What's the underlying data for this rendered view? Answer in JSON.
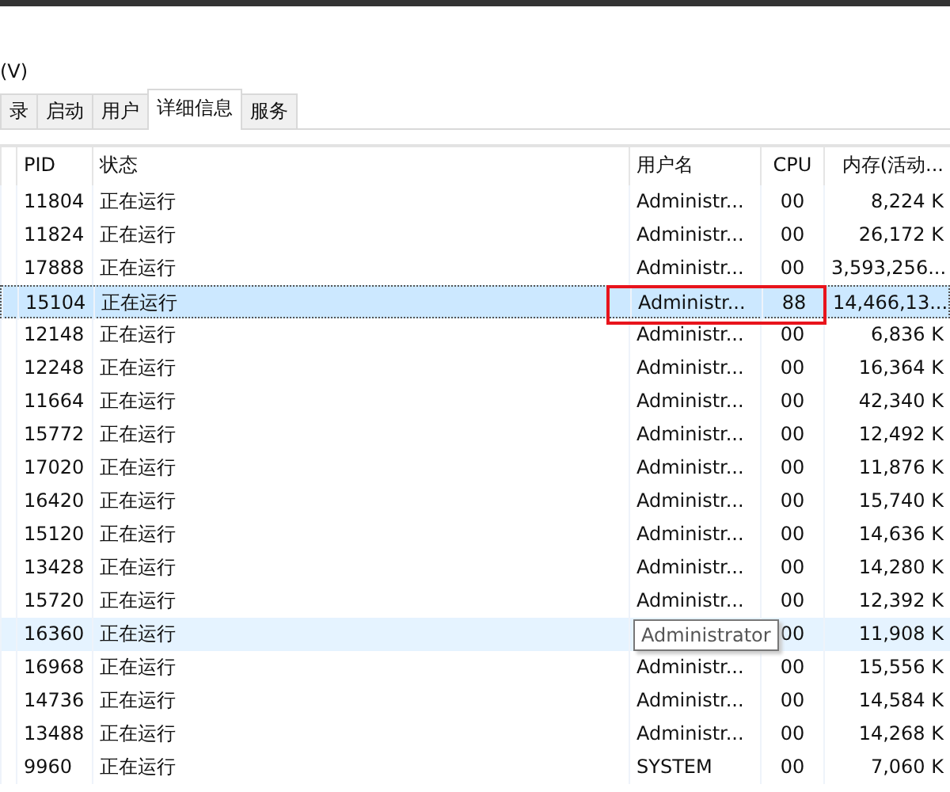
{
  "menu": {
    "label": "(V)"
  },
  "tabs": [
    {
      "label": "录",
      "selected": false
    },
    {
      "label": "启动",
      "selected": false
    },
    {
      "label": "用户",
      "selected": false
    },
    {
      "label": "详细信息",
      "selected": true
    },
    {
      "label": "服务",
      "selected": false
    }
  ],
  "table": {
    "columns": [
      "PID",
      "状态",
      "用户名",
      "CPU",
      "内存(活动..."
    ],
    "rows": [
      {
        "pid": "11804",
        "status": "正在运行",
        "user": "Administr...",
        "cpu": "00",
        "memory": "8,224 K",
        "selected": false,
        "hovered": false,
        "boxed": false
      },
      {
        "pid": "11824",
        "status": "正在运行",
        "user": "Administr...",
        "cpu": "00",
        "memory": "26,172 K",
        "selected": false,
        "hovered": false,
        "boxed": false
      },
      {
        "pid": "17888",
        "status": "正在运行",
        "user": "Administr...",
        "cpu": "00",
        "memory": "3,593,256...",
        "selected": false,
        "hovered": false,
        "boxed": false
      },
      {
        "pid": "15104",
        "status": "正在运行",
        "user": "Administr...",
        "cpu": "88",
        "memory": "14,466,13...",
        "selected": true,
        "hovered": false,
        "boxed": true
      },
      {
        "pid": "12148",
        "status": "正在运行",
        "user": "Administr...",
        "cpu": "00",
        "memory": "6,836 K",
        "selected": false,
        "hovered": false,
        "boxed": false
      },
      {
        "pid": "12248",
        "status": "正在运行",
        "user": "Administr...",
        "cpu": "00",
        "memory": "16,364 K",
        "selected": false,
        "hovered": false,
        "boxed": false
      },
      {
        "pid": "11664",
        "status": "正在运行",
        "user": "Administr...",
        "cpu": "00",
        "memory": "42,340 K",
        "selected": false,
        "hovered": false,
        "boxed": false
      },
      {
        "pid": "15772",
        "status": "正在运行",
        "user": "Administr...",
        "cpu": "00",
        "memory": "12,492 K",
        "selected": false,
        "hovered": false,
        "boxed": false
      },
      {
        "pid": "17020",
        "status": "正在运行",
        "user": "Administr...",
        "cpu": "00",
        "memory": "11,876 K",
        "selected": false,
        "hovered": false,
        "boxed": false
      },
      {
        "pid": "16420",
        "status": "正在运行",
        "user": "Administr...",
        "cpu": "00",
        "memory": "15,740 K",
        "selected": false,
        "hovered": false,
        "boxed": false
      },
      {
        "pid": "15120",
        "status": "正在运行",
        "user": "Administr...",
        "cpu": "00",
        "memory": "14,636 K",
        "selected": false,
        "hovered": false,
        "boxed": false
      },
      {
        "pid": "13428",
        "status": "正在运行",
        "user": "Administr...",
        "cpu": "00",
        "memory": "14,280 K",
        "selected": false,
        "hovered": false,
        "boxed": false
      },
      {
        "pid": "15720",
        "status": "正在运行",
        "user": "Administr...",
        "cpu": "00",
        "memory": "12,392 K",
        "selected": false,
        "hovered": false,
        "boxed": false
      },
      {
        "pid": "16360",
        "status": "正在运行",
        "tooltip": "Administrator",
        "cpu": "00",
        "memory": "11,908 K",
        "selected": false,
        "hovered": true,
        "boxed": false
      },
      {
        "pid": "16968",
        "status": "正在运行",
        "user": "Administr...",
        "cpu": "00",
        "memory": "15,556 K",
        "selected": false,
        "hovered": false,
        "boxed": false
      },
      {
        "pid": "14736",
        "status": "正在运行",
        "user": "Administr...",
        "cpu": "00",
        "memory": "14,584 K",
        "selected": false,
        "hovered": false,
        "boxed": false
      },
      {
        "pid": "13488",
        "status": "正在运行",
        "user": "Administr...",
        "cpu": "00",
        "memory": "14,268 K",
        "selected": false,
        "hovered": false,
        "boxed": false
      },
      {
        "pid": "9960",
        "status": "正在运行",
        "user": "SYSTEM",
        "cpu": "00",
        "memory": "7,060 K",
        "selected": false,
        "hovered": false,
        "boxed": false
      }
    ]
  }
}
